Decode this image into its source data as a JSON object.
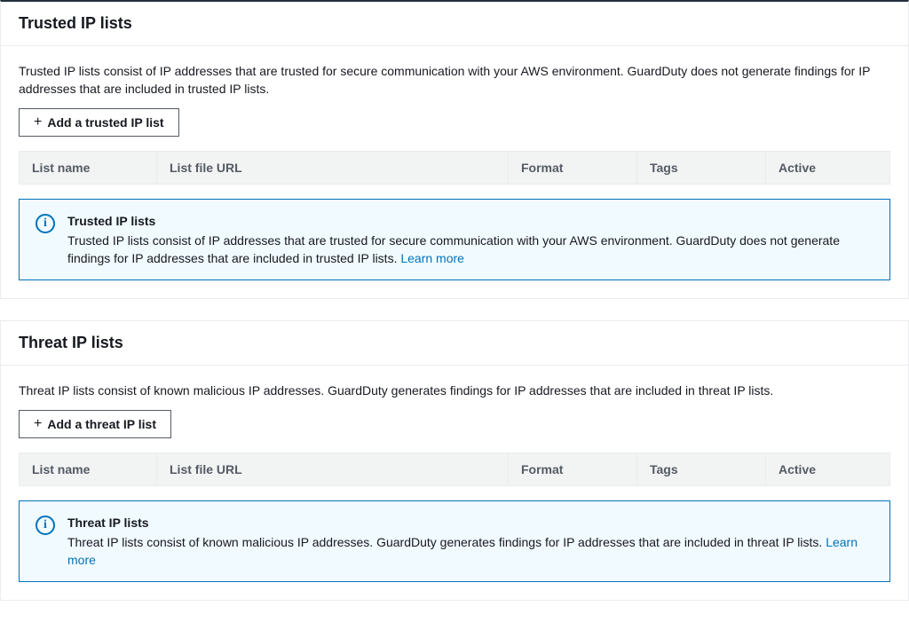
{
  "trusted": {
    "title": "Trusted IP lists",
    "description": "Trusted IP lists consist of IP addresses that are trusted for secure communication with your AWS environment. GuardDuty does not generate findings for IP addresses that are included in trusted IP lists.",
    "add_button": "Add a trusted IP list",
    "columns": {
      "name": "List name",
      "url": "List file URL",
      "format": "Format",
      "tags": "Tags",
      "active": "Active"
    },
    "info": {
      "title": "Trusted IP lists",
      "text": "Trusted IP lists consist of IP addresses that are trusted for secure communication with your AWS environment. GuardDuty does not generate findings for IP addresses that are included in trusted IP lists. ",
      "learn_more": "Learn more"
    }
  },
  "threat": {
    "title": "Threat IP lists",
    "description": "Threat IP lists consist of known malicious IP addresses. GuardDuty generates findings for IP addresses that are included in threat IP lists.",
    "add_button": "Add a threat IP list",
    "columns": {
      "name": "List name",
      "url": "List file URL",
      "format": "Format",
      "tags": "Tags",
      "active": "Active"
    },
    "info": {
      "title": "Threat IP lists",
      "text": "Threat IP lists consist of known malicious IP addresses. GuardDuty generates findings for IP addresses that are included in threat IP lists. ",
      "learn_more": "Learn more"
    }
  }
}
